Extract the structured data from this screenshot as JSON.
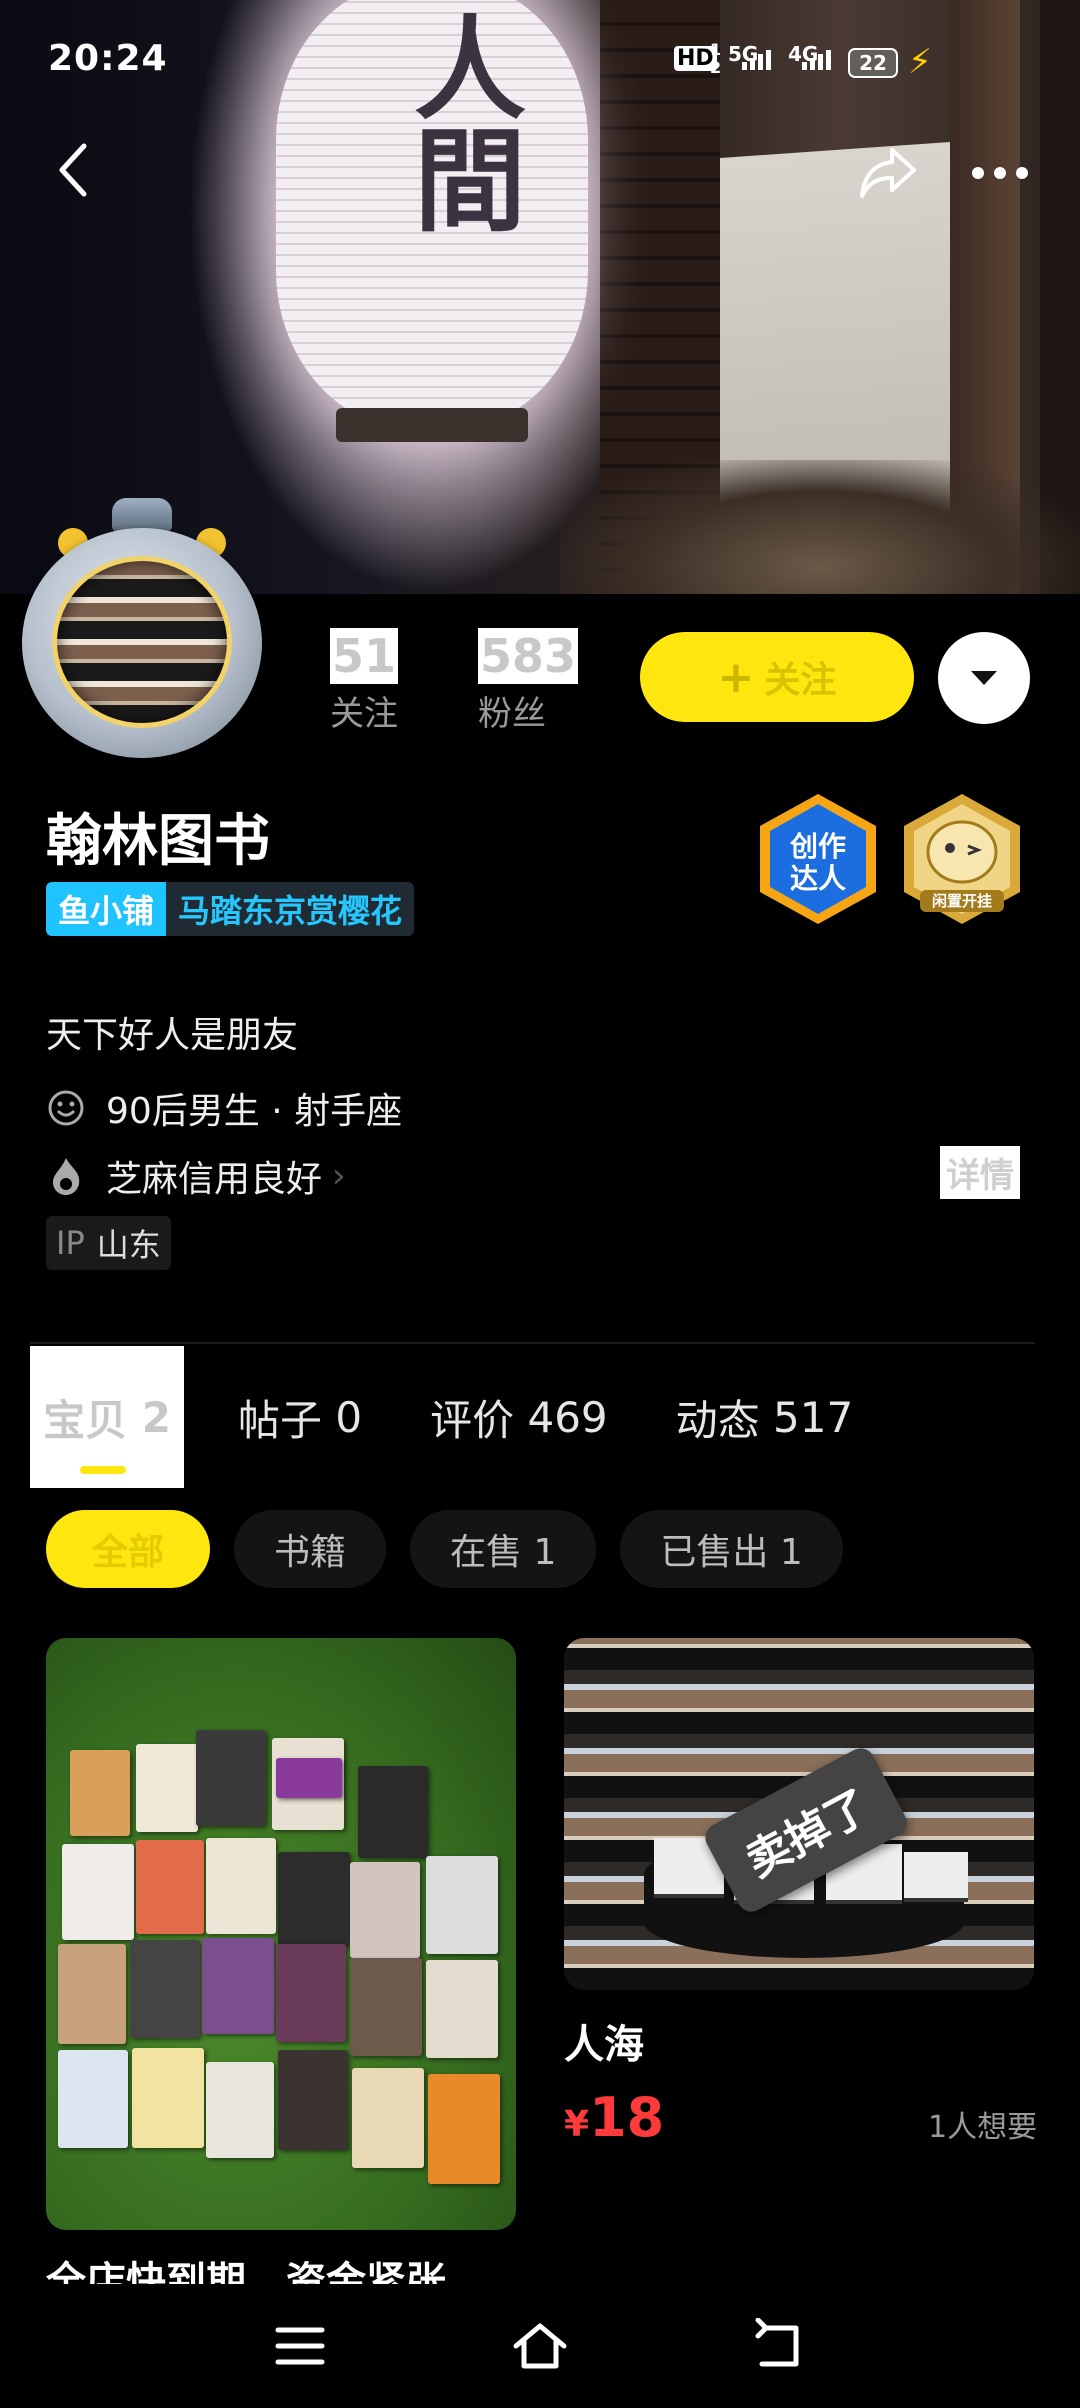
{
  "status_bar": {
    "time": "20:24",
    "hd": "HD",
    "sim1": "1",
    "sim2": "2",
    "net1": "5G",
    "net2": "4G",
    "battery": "22"
  },
  "cover": {
    "lantern_text": "人間"
  },
  "profile": {
    "following_count": "51",
    "following_label": "关注",
    "followers_count": "583",
    "followers_label": "粉丝",
    "follow_button": "关注",
    "name": "翰林图书",
    "shop_tag": "鱼小铺",
    "shop_name": "马踏东京赏樱花",
    "badge1_line1": "创作",
    "badge1_line2": "达人",
    "badge2_label": "闲置开挂",
    "bio": "天下好人是朋友",
    "age_sign": "90后男生 · 射手座",
    "credit": "芝麻信用良好",
    "detail": "详情",
    "ip_label": "IP",
    "ip_value": "山东"
  },
  "tabs": [
    {
      "label": "宝贝",
      "count": "2"
    },
    {
      "label": "帖子",
      "count": "0"
    },
    {
      "label": "评价",
      "count": "469"
    },
    {
      "label": "动态",
      "count": "517"
    }
  ],
  "filters": [
    "全部",
    "书籍",
    "在售 1",
    "已售出 1"
  ],
  "items": [
    {
      "title": "全店快到期，资金紧张"
    },
    {
      "title": "人海",
      "currency": "¥",
      "price": "18",
      "wants": "1人想要",
      "status": "卖掉了"
    }
  ],
  "colors": {
    "accent_yellow": "#ffe60f",
    "price_red": "#ff3a3a",
    "shop_blue": "#1ec3ff"
  }
}
